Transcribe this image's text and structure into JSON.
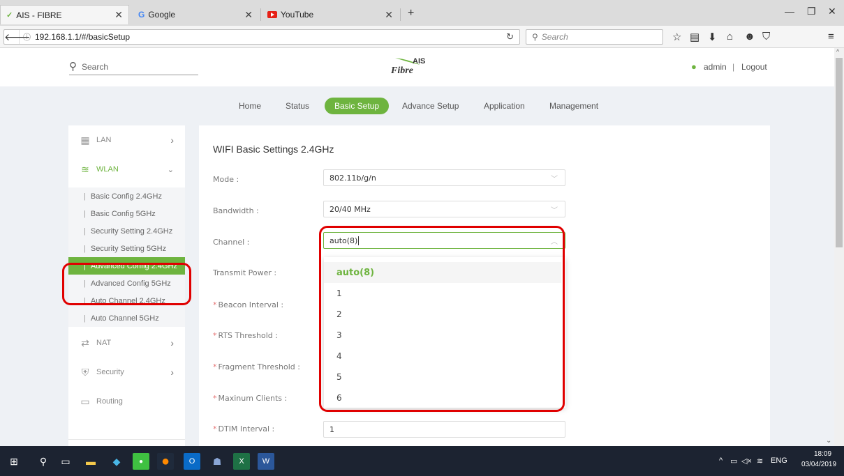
{
  "browser": {
    "tabs": [
      {
        "title": "AIS - FIBRE",
        "favicon": "ais-logo-icon"
      },
      {
        "title": "Google",
        "favicon": "google-icon"
      },
      {
        "title": "YouTube",
        "favicon": "youtube-icon"
      }
    ],
    "new_tab_label": "+",
    "url": "192.168.1.1/#/basicSetup",
    "search_placeholder": "Search"
  },
  "header": {
    "search_label": "Search",
    "logo_line1": "AIS",
    "logo_line2": "Fibre",
    "user": "admin",
    "separator": "|",
    "logout": "Logout"
  },
  "topnav": [
    "Home",
    "Status",
    "Basic Setup",
    "Advance Setup",
    "Application",
    "Management"
  ],
  "sidebar": {
    "lan": "LAN",
    "wlan": "WLAN",
    "wlan_items": [
      "Basic Config 2.4GHz",
      "Basic Config 5GHz",
      "Security Setting 2.4GHz",
      "Security Setting 5GHz",
      "Advanced Config 2.4GHz",
      "Advanced Config 5GHz",
      "Auto Channel 2.4GHz",
      "Auto Channel 5GHz"
    ],
    "nat": "NAT",
    "security": "Security",
    "routing": "Routing",
    "sub_bar": "|"
  },
  "content": {
    "title": "WIFI Basic Settings 2.4GHz",
    "required_mark": "*",
    "fields": {
      "mode": {
        "label": "Mode :",
        "value": "802.11b/g/n"
      },
      "bandwidth": {
        "label": "Bandwidth :",
        "value": "20/40 MHz"
      },
      "channel": {
        "label": "Channel :",
        "value": "auto(8)"
      },
      "transmit_power": {
        "label": "Transmit Power :"
      },
      "beacon_interval": {
        "label": "Beacon Interval :"
      },
      "rts_threshold": {
        "label": "RTS Threshold :"
      },
      "fragment_threshold": {
        "label": "Fragment Threshold :"
      },
      "max_clients": {
        "label": "Maxinum Clients :"
      },
      "dtim_interval": {
        "label": "DTIM Interval :",
        "value": "1"
      }
    },
    "channel_options": [
      "auto(8)",
      "1",
      "2",
      "3",
      "4",
      "5",
      "6"
    ],
    "selected_option": "auto(8)"
  },
  "taskbar": {
    "lang": "ENG",
    "time": "18:09",
    "date": "03/04/2019"
  },
  "colors": {
    "accent": "#6eb43f",
    "highlight_box": "#e00000"
  }
}
